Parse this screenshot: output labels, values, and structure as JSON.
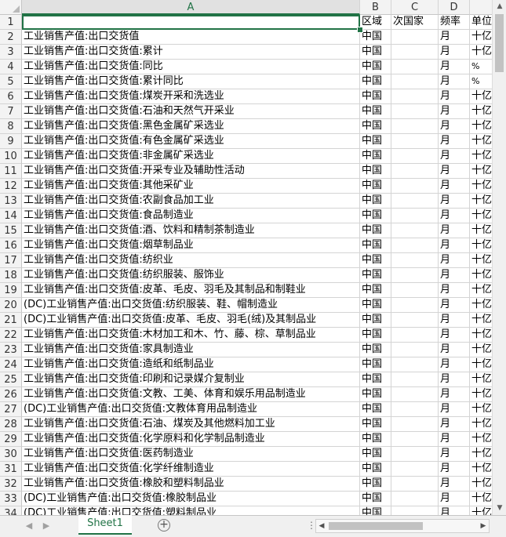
{
  "columns": [
    "A",
    "B",
    "C",
    "D",
    ""
  ],
  "header_row": [
    "",
    "区域",
    "次国家",
    "频率",
    "单位"
  ],
  "rows": [
    {
      "n": "2",
      "a": "工业销售产值:出口交货值",
      "b": "中国",
      "c": "",
      "d": "月",
      "e": "十亿"
    },
    {
      "n": "3",
      "a": "工业销售产值:出口交货值:累计",
      "b": "中国",
      "c": "",
      "d": "月",
      "e": "十亿"
    },
    {
      "n": "4",
      "a": "工业销售产值:出口交货值:同比",
      "b": "中国",
      "c": "",
      "d": "月",
      "e": "%"
    },
    {
      "n": "5",
      "a": "工业销售产值:出口交货值:累计同比",
      "b": "中国",
      "c": "",
      "d": "月",
      "e": "%"
    },
    {
      "n": "6",
      "a": "工业销售产值:出口交货值:煤炭开采和洗选业",
      "b": "中国",
      "c": "",
      "d": "月",
      "e": "十亿"
    },
    {
      "n": "7",
      "a": "工业销售产值:出口交货值:石油和天然气开采业",
      "b": "中国",
      "c": "",
      "d": "月",
      "e": "十亿"
    },
    {
      "n": "8",
      "a": "工业销售产值:出口交货值:黑色金属矿采选业",
      "b": "中国",
      "c": "",
      "d": "月",
      "e": "十亿"
    },
    {
      "n": "9",
      "a": "工业销售产值:出口交货值:有色金属矿采选业",
      "b": "中国",
      "c": "",
      "d": "月",
      "e": "十亿"
    },
    {
      "n": "10",
      "a": "工业销售产值:出口交货值:非金属矿采选业",
      "b": "中国",
      "c": "",
      "d": "月",
      "e": "十亿"
    },
    {
      "n": "11",
      "a": "工业销售产值:出口交货值:开采专业及辅助性活动",
      "b": "中国",
      "c": "",
      "d": "月",
      "e": "十亿"
    },
    {
      "n": "12",
      "a": "工业销售产值:出口交货值:其他采矿业",
      "b": "中国",
      "c": "",
      "d": "月",
      "e": "十亿"
    },
    {
      "n": "13",
      "a": "工业销售产值:出口交货值:农副食品加工业",
      "b": "中国",
      "c": "",
      "d": "月",
      "e": "十亿"
    },
    {
      "n": "14",
      "a": "工业销售产值:出口交货值:食品制造业",
      "b": "中国",
      "c": "",
      "d": "月",
      "e": "十亿"
    },
    {
      "n": "15",
      "a": "工业销售产值:出口交货值:酒、饮料和精制茶制造业",
      "b": "中国",
      "c": "",
      "d": "月",
      "e": "十亿"
    },
    {
      "n": "16",
      "a": "工业销售产值:出口交货值:烟草制品业",
      "b": "中国",
      "c": "",
      "d": "月",
      "e": "十亿"
    },
    {
      "n": "17",
      "a": "工业销售产值:出口交货值:纺织业",
      "b": "中国",
      "c": "",
      "d": "月",
      "e": "十亿"
    },
    {
      "n": "18",
      "a": "工业销售产值:出口交货值:纺织服装、服饰业",
      "b": "中国",
      "c": "",
      "d": "月",
      "e": "十亿"
    },
    {
      "n": "19",
      "a": "工业销售产值:出口交货值:皮革、毛皮、羽毛及其制品和制鞋业",
      "b": "中国",
      "c": "",
      "d": "月",
      "e": "十亿"
    },
    {
      "n": "20",
      "a": "(DC)工业销售产值:出口交货值:纺织服装、鞋、帽制造业",
      "b": "中国",
      "c": "",
      "d": "月",
      "e": "十亿"
    },
    {
      "n": "21",
      "a": "(DC)工业销售产值:出口交货值:皮革、毛皮、羽毛(绒)及其制品业",
      "b": "中国",
      "c": "",
      "d": "月",
      "e": "十亿"
    },
    {
      "n": "22",
      "a": "工业销售产值:出口交货值:木材加工和木、竹、藤、棕、草制品业",
      "b": "中国",
      "c": "",
      "d": "月",
      "e": "十亿"
    },
    {
      "n": "23",
      "a": "工业销售产值:出口交货值:家具制造业",
      "b": "中国",
      "c": "",
      "d": "月",
      "e": "十亿"
    },
    {
      "n": "24",
      "a": "工业销售产值:出口交货值:造纸和纸制品业",
      "b": "中国",
      "c": "",
      "d": "月",
      "e": "十亿"
    },
    {
      "n": "25",
      "a": "工业销售产值:出口交货值:印刷和记录媒介复制业",
      "b": "中国",
      "c": "",
      "d": "月",
      "e": "十亿"
    },
    {
      "n": "26",
      "a": "工业销售产值:出口交货值:文教、工美、体育和娱乐用品制造业",
      "b": "中国",
      "c": "",
      "d": "月",
      "e": "十亿"
    },
    {
      "n": "27",
      "a": "(DC)工业销售产值:出口交货值:文教体育用品制造业",
      "b": "中国",
      "c": "",
      "d": "月",
      "e": "十亿"
    },
    {
      "n": "28",
      "a": "工业销售产值:出口交货值:石油、煤炭及其他燃料加工业",
      "b": "中国",
      "c": "",
      "d": "月",
      "e": "十亿"
    },
    {
      "n": "29",
      "a": "工业销售产值:出口交货值:化学原料和化学制品制造业",
      "b": "中国",
      "c": "",
      "d": "月",
      "e": "十亿"
    },
    {
      "n": "30",
      "a": "工业销售产值:出口交货值:医药制造业",
      "b": "中国",
      "c": "",
      "d": "月",
      "e": "十亿"
    },
    {
      "n": "31",
      "a": "工业销售产值:出口交货值:化学纤维制造业",
      "b": "中国",
      "c": "",
      "d": "月",
      "e": "十亿"
    },
    {
      "n": "32",
      "a": "工业销售产值:出口交货值:橡胶和塑料制品业",
      "b": "中国",
      "c": "",
      "d": "月",
      "e": "十亿"
    },
    {
      "n": "33",
      "a": "(DC)工业销售产值:出口交货值:橡胶制品业",
      "b": "中国",
      "c": "",
      "d": "月",
      "e": "十亿"
    },
    {
      "n": "34",
      "a": "(DC)工业销售产值:出口交货值:塑料制品业",
      "b": "中国",
      "c": "",
      "d": "月",
      "e": "十亿"
    }
  ],
  "header_row_number": "1",
  "sheet_tab": "Sheet1",
  "add_sheet_symbol": "+",
  "tab_dots": "⋮",
  "icons": {
    "scroll_up": "▲",
    "scroll_down": "▼",
    "scroll_left": "◀",
    "scroll_right": "▶",
    "nav_prev": "◀",
    "nav_next": "▶"
  },
  "colors": {
    "accent": "#217346",
    "grid": "#d4d4d4",
    "header_bg": "#f3f3f3"
  }
}
